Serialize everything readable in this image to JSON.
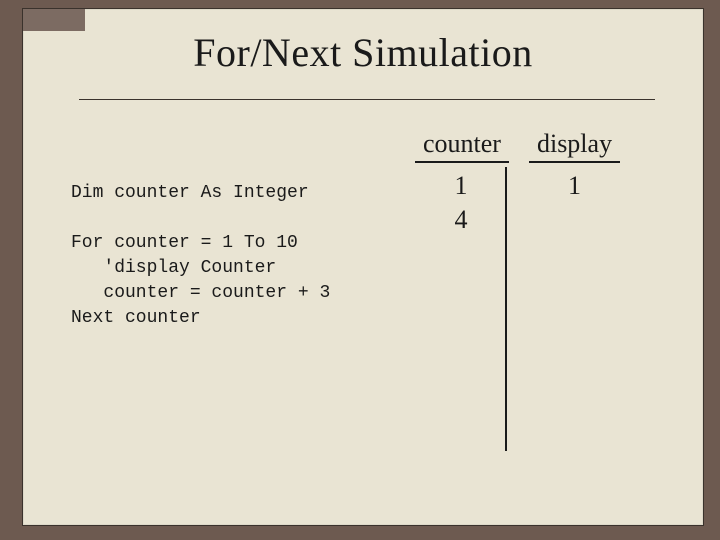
{
  "title": "For/Next Simulation",
  "code": {
    "l1": "Dim counter As Integer",
    "l2": "",
    "l3": "For counter = 1 To 10",
    "l4": "   'display Counter",
    "l5": "   counter = counter + 3",
    "l6": "Next counter"
  },
  "columns": {
    "counter": {
      "header": "counter",
      "values": [
        "1",
        "4"
      ]
    },
    "display": {
      "header": "display",
      "values": [
        "1"
      ]
    }
  }
}
